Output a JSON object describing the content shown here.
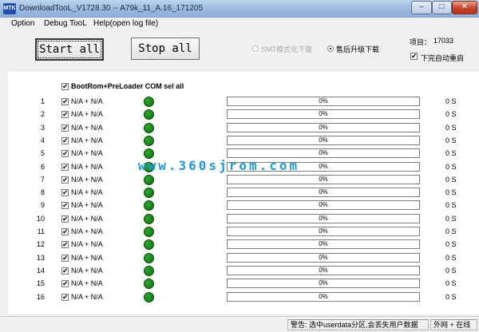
{
  "window": {
    "title": "DownloadTooL_V1728.30 -- A79k_11_A.16_171205",
    "icon_text": "MTK",
    "minimize": "–",
    "maximize": "□",
    "close": "✕"
  },
  "menu": [
    "Option",
    "Debug TooL",
    "Help(open log file)"
  ],
  "toolbar": {
    "start_label": "Start all",
    "stop_label": "Stop all",
    "mode_factory_label": "SMT模式化下载",
    "mode_after_sales_label": "售后升级下载",
    "project_label": "项目：",
    "project_value": "17033",
    "auto_reboot_label": "下完自动重启"
  },
  "list": {
    "select_all_label": "BootRom+PreLoader COM sel all",
    "rows": [
      {
        "num": "1",
        "label": "N/A + N/A",
        "progress_text": "0%",
        "progress": 0,
        "time": "0 S"
      },
      {
        "num": "2",
        "label": "N/A + N/A",
        "progress_text": "0%",
        "progress": 0,
        "time": "0 S"
      },
      {
        "num": "3",
        "label": "N/A + N/A",
        "progress_text": "0%",
        "progress": 0,
        "time": "0 S"
      },
      {
        "num": "4",
        "label": "N/A + N/A",
        "progress_text": "0%",
        "progress": 0,
        "time": "0 S"
      },
      {
        "num": "5",
        "label": "N/A + N/A",
        "progress_text": "0%",
        "progress": 0,
        "time": "0 S"
      },
      {
        "num": "6",
        "label": "N/A + N/A",
        "progress_text": "0%",
        "progress": 0,
        "time": "0 S"
      },
      {
        "num": "7",
        "label": "N/A + N/A",
        "progress_text": "0%",
        "progress": 0,
        "time": "0 S"
      },
      {
        "num": "8",
        "label": "N/A + N/A",
        "progress_text": "0%",
        "progress": 0,
        "time": "0 S"
      },
      {
        "num": "9",
        "label": "N/A + N/A",
        "progress_text": "0%",
        "progress": 0,
        "time": "0 S"
      },
      {
        "num": "10",
        "label": "N/A + N/A",
        "progress_text": "0%",
        "progress": 0,
        "time": "0 S"
      },
      {
        "num": "11",
        "label": "N/A + N/A",
        "progress_text": "0%",
        "progress": 0,
        "time": "0 S"
      },
      {
        "num": "12",
        "label": "N/A + N/A",
        "progress_text": "0%",
        "progress": 0,
        "time": "0 S"
      },
      {
        "num": "13",
        "label": "N/A + N/A",
        "progress_text": "0%",
        "progress": 0,
        "time": "0 S"
      },
      {
        "num": "14",
        "label": "N/A + N/A",
        "progress_text": "0%",
        "progress": 0,
        "time": "0 S"
      },
      {
        "num": "15",
        "label": "N/A + N/A",
        "progress_text": "0%",
        "progress": 0,
        "time": "0 S"
      },
      {
        "num": "16",
        "label": "N/A + N/A",
        "progress_text": "0%",
        "progress": 0,
        "time": "0 S"
      }
    ]
  },
  "watermark": "www.360sjrom.com",
  "status": {
    "warning": "警告: 选中userdata分区,会丢失用户数据",
    "network": "外网 + 在线"
  },
  "colors": {
    "status_dot": "#1a8a1a",
    "title_bar": "#9bb9df",
    "watermark": "#1e9bd7"
  }
}
